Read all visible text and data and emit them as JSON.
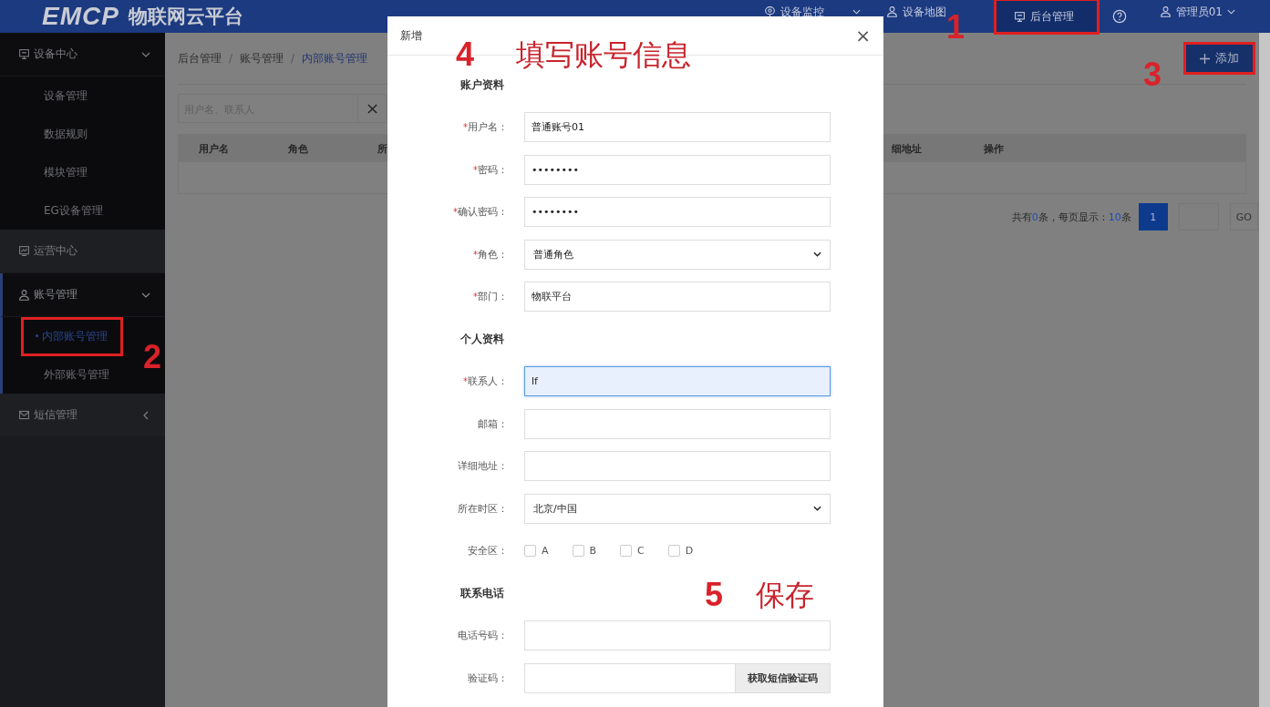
{
  "header": {
    "logo": "EMCP",
    "title": "物联网云平台",
    "nav": [
      {
        "label": "设备监控",
        "selected": false,
        "highlighted": false
      },
      {
        "label": "设备地图",
        "selected": false,
        "highlighted": false
      },
      {
        "label": "后台管理",
        "selected": true,
        "highlighted": true
      }
    ],
    "user": "管理员01"
  },
  "sidebar": {
    "groups": [
      {
        "label": "设备中心",
        "expanded": true,
        "active": false,
        "children": [
          {
            "label": "设备管理",
            "selected": false,
            "highlighted": false
          },
          {
            "label": "数据规则",
            "selected": false,
            "highlighted": false
          },
          {
            "label": "模块管理",
            "selected": false,
            "highlighted": false
          },
          {
            "label": "EG设备管理",
            "selected": false,
            "highlighted": false
          }
        ]
      },
      {
        "label": "运营中心",
        "expanded": false,
        "active": false
      },
      {
        "label": "账号管理",
        "expanded": true,
        "active": true,
        "children": [
          {
            "label": "内部账号管理",
            "selected": true,
            "highlighted": true
          },
          {
            "label": "外部账号管理",
            "selected": false,
            "highlighted": false
          }
        ]
      },
      {
        "label": "短信管理",
        "expanded": false,
        "active": false
      }
    ]
  },
  "breadcrumb": {
    "separator": "/",
    "items": [
      "后台管理",
      "账号管理",
      "内部账号管理"
    ]
  },
  "add_button": {
    "label": "添加",
    "highlighted": true
  },
  "search": {
    "placeholder": "用户名、联系人"
  },
  "table": {
    "columns": [
      "用户名",
      "角色",
      "所",
      "细地址",
      "操作"
    ]
  },
  "pagination": {
    "summary": [
      {
        "text": "共有",
        "highlight": false
      },
      {
        "text": "0",
        "highlight": true
      },
      {
        "text": "条，每页显示：",
        "highlight": false
      },
      {
        "text": "10",
        "highlight": true
      },
      {
        "text": "条",
        "highlight": false
      }
    ],
    "pages": [
      {
        "label": "1",
        "selected": true
      }
    ],
    "go": "GO"
  },
  "dialog": {
    "title": "新增",
    "close": "×",
    "sections": [
      {
        "title": "账户资料",
        "fields": [
          {
            "label": "用户名：",
            "required_mark": "*",
            "kind": "input",
            "value": "普通账号01",
            "focused": false
          },
          {
            "label": "密码：",
            "required_mark": "*",
            "kind": "input",
            "value": "••••••••",
            "focused": false
          },
          {
            "label": "确认密码：",
            "required_mark": "*",
            "kind": "input",
            "value": "••••••••",
            "focused": false
          },
          {
            "label": "角色：",
            "required_mark": "*",
            "kind": "select",
            "value": "普通角色"
          },
          {
            "label": "部门：",
            "required_mark": "*",
            "kind": "input",
            "value": "物联平台",
            "focused": false
          }
        ]
      },
      {
        "title": "个人资料",
        "fields": [
          {
            "label": "联系人：",
            "required_mark": "*",
            "kind": "input",
            "value": "lf",
            "focused": true
          },
          {
            "label": "邮箱：",
            "kind": "input",
            "focused": false
          },
          {
            "label": "详细地址：",
            "kind": "input",
            "focused": false
          },
          {
            "label": "所在时区：",
            "kind": "select",
            "value": "北京/中国"
          },
          {
            "label": "安全区：",
            "kind": "checkboxes",
            "options": [
              {
                "label": "A",
                "checked": false
              },
              {
                "label": "B",
                "checked": false
              },
              {
                "label": "C",
                "checked": false
              },
              {
                "label": "D",
                "checked": false
              }
            ]
          }
        ]
      },
      {
        "title": "联系电话",
        "fields": [
          {
            "label": "电话号码：",
            "kind": "input",
            "focused": false
          },
          {
            "label": "验证码：",
            "kind": "input_button",
            "button": "获取短信验证码"
          }
        ]
      }
    ]
  },
  "annotations": [
    {
      "number": "1"
    },
    {
      "number": "2"
    },
    {
      "number": "3"
    },
    {
      "number": "4",
      "text": "填写账号信息"
    },
    {
      "number": "5",
      "text": "保存"
    }
  ]
}
